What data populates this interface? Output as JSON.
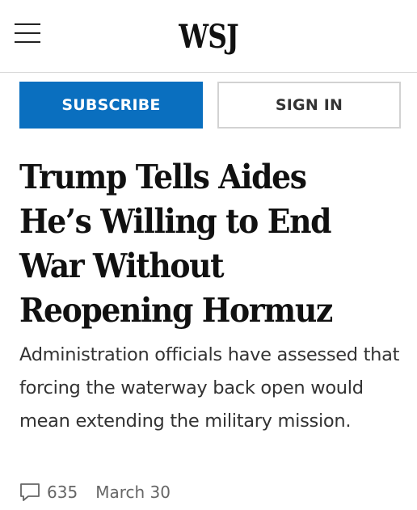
{
  "header": {
    "logo": "WSJ",
    "menu_icon": "hamburger-menu-icon"
  },
  "actions": {
    "subscribe_label": "SUBSCRIBE",
    "signin_label": "SIGN IN"
  },
  "article": {
    "headline": "Trump Tells Aides He’s Willing to End War Without Reopening Hormuz",
    "dek": "Administration officials have assessed that forcing the waterway back open would mean extending the military mission.",
    "comment_icon": "speech-bubble-icon",
    "comment_count": "635",
    "date": "March 30"
  },
  "colors": {
    "subscribe_bg": "#0a6fbf",
    "text": "#111111",
    "muted": "#666666"
  }
}
